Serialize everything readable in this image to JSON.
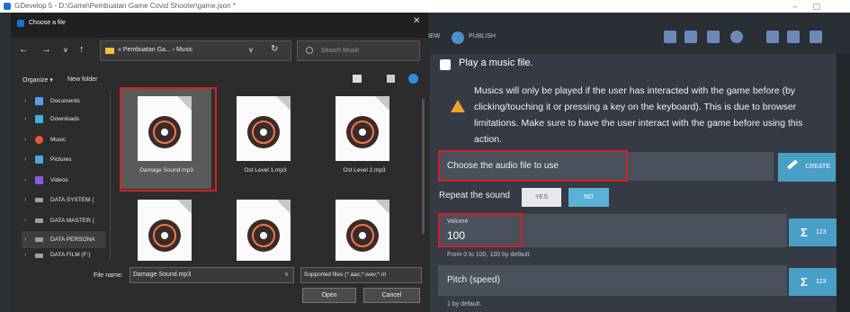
{
  "window": {
    "title": "GDevelop 5 - D:\\Game\\Pembuatan Game Covid Shooter\\game.json *",
    "minimize": "–",
    "maximize": "▢"
  },
  "toolbar": {
    "publish_partial": "IEW",
    "publish_label": "PUBLISH"
  },
  "action_panel": {
    "title": "Play a music file.",
    "warning": "Musics will only be played if the user has interacted with the game before (by clicking/touching it or pressing a key on the keyboard). This is due to browser limitations. Make sure to have the user interact with the game before using this action.",
    "audio_field_label": "Choose the audio file to use",
    "create_label": "CREATE",
    "repeat_label": "Repeat the sound",
    "repeat_yes": "YES",
    "repeat_no": "NO",
    "repeat_value": "NO",
    "volume_label": "Volume",
    "volume_value": "100",
    "volume_help": "From 0 to 100, 100 by default.",
    "pitch_label": "Pitch (speed)",
    "pitch_help": "1 by default.",
    "sum_sigma": "Σ",
    "sum_num": "123"
  },
  "file_dialog": {
    "title": "Choose a file",
    "close": "✕",
    "nav": {
      "back": "←",
      "forward": "→",
      "recent": "∨",
      "up": "↑",
      "refresh": "↻"
    },
    "address": "« Pembuatan Ga... › Music",
    "address_dropdown": "∨",
    "search_placeholder": "Search Music",
    "organize": "Organize ▾",
    "new_folder": "New folder",
    "sidebar": [
      {
        "label": "Documents",
        "color": "#5aa0e8"
      },
      {
        "label": "Downloads",
        "color": "#3fb0e0"
      },
      {
        "label": "Music",
        "color": "#e8563f"
      },
      {
        "label": "Pictures",
        "color": "#4aa8e0"
      },
      {
        "label": "Videos",
        "color": "#8a5ae0"
      },
      {
        "label": "DATA SYSTEM (",
        "color": "#9aa0a8"
      },
      {
        "label": "DATA MASTER (",
        "color": "#9aa0a8"
      },
      {
        "label": "DATA PERSONA",
        "color": "#9aa0a8"
      },
      {
        "label": "DATA FILM (F:)",
        "color": "#9aa0a8"
      }
    ],
    "files": [
      {
        "name": "Damage Sound.mp3",
        "selected": true
      },
      {
        "name": "Ost Level 1.mp3",
        "selected": false
      },
      {
        "name": "Ost Level 2.mp3",
        "selected": false
      },
      {
        "name": "",
        "selected": false
      },
      {
        "name": "",
        "selected": false
      },
      {
        "name": "",
        "selected": false
      }
    ],
    "filename_label": "File name:",
    "filename_value": "Damage Sound.mp3",
    "filter_value": "Supported files (*.aac;*.wav;*.m",
    "open_label": "Open",
    "cancel_label": "Cancel"
  },
  "colors": {
    "accent": "#4a9fc7",
    "highlight": "#d62020",
    "warning": "#f0a030"
  }
}
